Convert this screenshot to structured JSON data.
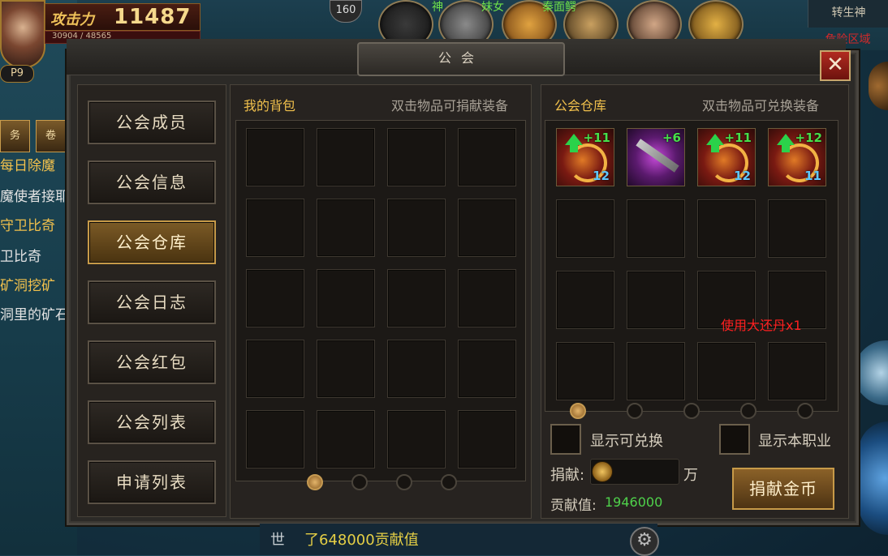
{
  "hud": {
    "power_label": "攻击力",
    "power_value": "11487",
    "hp_text": "30904 / 48565",
    "level_badge": "P9",
    "player_level": "160",
    "top_names": [
      "神",
      "妹女",
      "秦面鳄"
    ],
    "top_right_1": "转生神",
    "top_right_2": "危险区域"
  },
  "side_menu": {
    "buttons": [
      "务",
      "卷"
    ],
    "items": [
      {
        "label": "每日除魔",
        "color": "gold"
      },
      {
        "label": "魔使者接耶",
        "color": "white"
      },
      {
        "label": "守卫比奇",
        "color": "gold"
      },
      {
        "label": "卫比奇",
        "color": "white"
      },
      {
        "label": "矿洞挖矿",
        "color": "gold"
      },
      {
        "label": "洞里的矿石",
        "color": "white"
      }
    ]
  },
  "dialog": {
    "title": "公会",
    "close_label": "✕",
    "nav": [
      {
        "label": "公会成员",
        "active": false
      },
      {
        "label": "公会信息",
        "active": false
      },
      {
        "label": "公会仓库",
        "active": true
      },
      {
        "label": "公会日志",
        "active": false
      },
      {
        "label": "公会红包",
        "active": false
      },
      {
        "label": "公会列表",
        "active": false
      },
      {
        "label": "申请列表",
        "active": false
      }
    ],
    "bag": {
      "title": "我的背包",
      "hint": "双击物品可捐献装备",
      "page_count": 4,
      "current_page": 1
    },
    "store": {
      "title": "公会仓库",
      "hint": "双击物品可兑换装备",
      "items": [
        {
          "plus": "+11",
          "count": "12",
          "kind": "red",
          "upgrade": true
        },
        {
          "plus": "+6",
          "count": "",
          "kind": "purple",
          "upgrade": false
        },
        {
          "plus": "+11",
          "count": "12",
          "kind": "red",
          "upgrade": true
        },
        {
          "plus": "+12",
          "count": "11",
          "kind": "red",
          "upgrade": true
        }
      ],
      "page_count": 5,
      "current_page": 1,
      "floating_text": "使用大还丹x1",
      "show_exchangeable": "显示可兑换",
      "show_my_class": "显示本职业",
      "donate_label": "捐献:",
      "donate_unit": "万",
      "contribution_label": "贡献值:",
      "contribution_value": "1946000",
      "donate_button": "捐献金币"
    }
  },
  "chat": {
    "channel": "世",
    "message": "了648000贡献值",
    "gear_icon": "⚙"
  }
}
